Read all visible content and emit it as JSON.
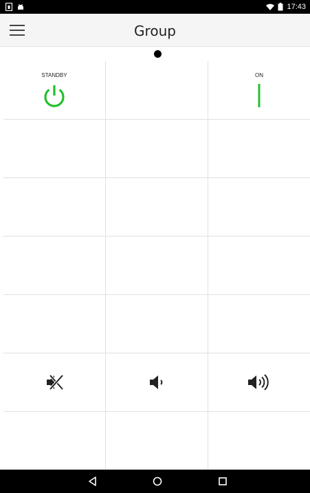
{
  "status_bar": {
    "time": "17:43",
    "icons": [
      "sim-icon",
      "android-icon",
      "wifi-icon",
      "battery-icon"
    ]
  },
  "app_bar": {
    "title": "Group",
    "menu_icon": "hamburger-menu-icon"
  },
  "pager": {
    "pages": 1,
    "current": 1
  },
  "grid": {
    "standby_label": "STANDBY",
    "on_label": "ON",
    "standby_icon": "power-icon",
    "on_icon": "power-on-bar-icon",
    "mute_icon": "mute-icon",
    "volume_down_icon": "volume-down-icon",
    "volume_up_icon": "volume-up-icon",
    "accent_color": "#22c02a"
  },
  "nav_bar": {
    "icons": [
      "back-icon",
      "home-icon",
      "recents-icon"
    ]
  }
}
